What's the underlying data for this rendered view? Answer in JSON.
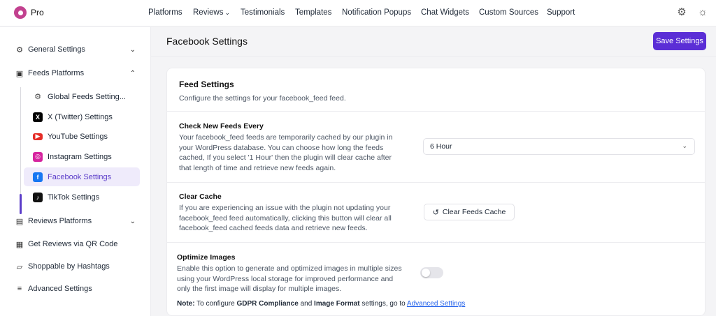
{
  "brand": {
    "name": "Pro"
  },
  "nav": {
    "items": [
      "Platforms",
      "Reviews",
      "Testimonials",
      "Templates",
      "Notification Popups",
      "Chat Widgets",
      "Custom Sources",
      "Support"
    ]
  },
  "sidebar": {
    "general": "General Settings",
    "feeds": "Feeds Platforms",
    "sub": [
      "Global Feeds Setting...",
      "X (Twitter) Settings",
      "YouTube Settings",
      "Instagram Settings",
      "Facebook Settings",
      "TikTok Settings"
    ],
    "reviews": "Reviews Platforms",
    "qr": "Get Reviews via QR Code",
    "shoppable": "Shoppable by Hashtags",
    "advanced": "Advanced Settings"
  },
  "header": {
    "title": "Facebook Settings",
    "save_label": "Save Settings"
  },
  "card": {
    "title": "Feed Settings",
    "subtitle": "Configure the settings for your facebook_feed feed.",
    "check": {
      "title": "Check New Feeds Every",
      "lines": [
        "Your facebook_feed feeds are temporarily cached by our plugin in",
        "your WordPress database. You can choose how long the feeds",
        "cached, If you select '1 Hour' then the plugin will clear cache after",
        "that length of time and retrieve new feeds again."
      ],
      "value": "6 Hour"
    },
    "clear": {
      "title": "Clear Cache",
      "lines": [
        "If you are experiencing an issue with the plugin not updating your",
        "facebook_feed feed automatically, clicking this button will clear all",
        "facebook_feed cached feeds data and retrieve new feeds."
      ],
      "button": "Clear Feeds Cache"
    },
    "optimize": {
      "title": "Optimize Images",
      "lines": [
        "Enable this option to generate and optimized images in multiple sizes",
        "using your WordPress local storage for improved performance and",
        "only the first image will display for multiple images."
      ],
      "enabled": false
    },
    "note": {
      "label": "Note:",
      "t1": "To configure",
      "b1": "GDPR Compliance",
      "t2": "and",
      "b2": "Image Format",
      "t3": "settings, go to",
      "link": "Advanced Settings"
    }
  },
  "colors": {
    "accent": "#5b2ed6",
    "active_bg": "#efebfb",
    "link": "#2563eb"
  }
}
